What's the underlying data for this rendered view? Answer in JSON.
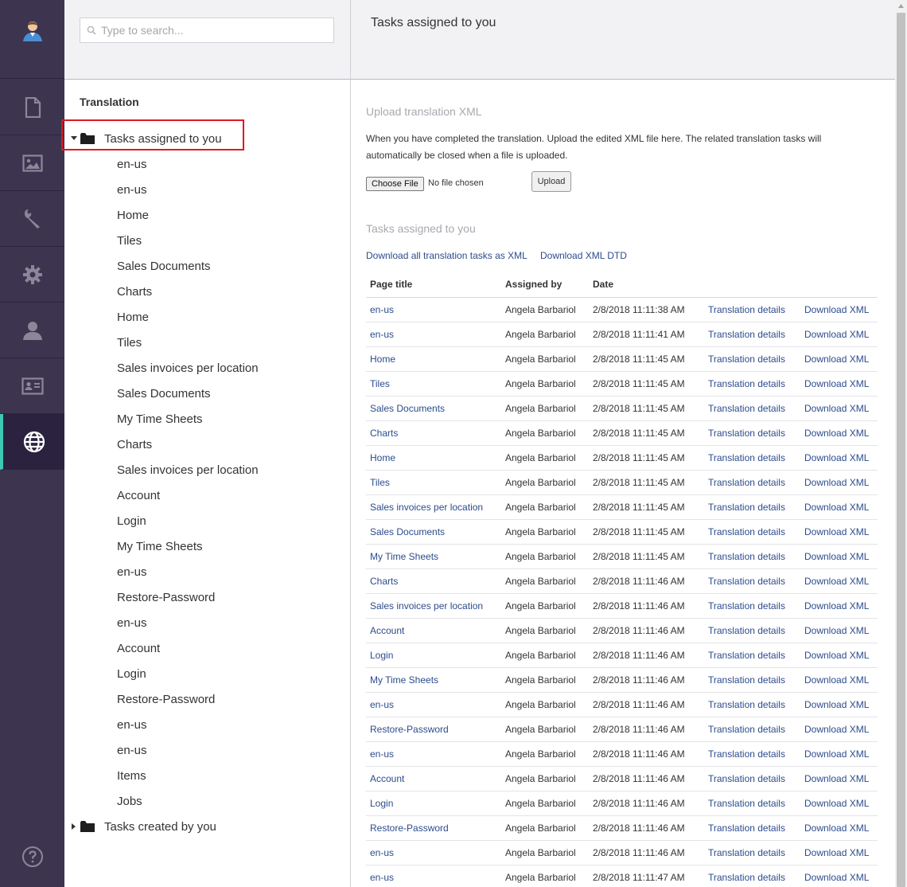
{
  "rail": {
    "items": [
      {
        "name": "documents",
        "icon": "document-icon"
      },
      {
        "name": "media",
        "icon": "image-icon"
      },
      {
        "name": "tools",
        "icon": "wrench-icon"
      },
      {
        "name": "settings",
        "icon": "gear-icon"
      },
      {
        "name": "users",
        "icon": "user-icon"
      },
      {
        "name": "contacts",
        "icon": "id-card-icon"
      },
      {
        "name": "translation",
        "icon": "globe-icon",
        "active": true
      }
    ],
    "active_color": "#3cc9b5",
    "background": "#3d3550"
  },
  "search": {
    "placeholder": "Type to search...",
    "value": ""
  },
  "tree": {
    "title": "Translation",
    "assigned_label": "Tasks assigned to you",
    "created_label": "Tasks created by you",
    "children": [
      "en-us",
      "en-us",
      "Home",
      "Tiles",
      "Sales Documents",
      "Charts",
      "Home",
      "Tiles",
      "Sales invoices per location",
      "Sales Documents",
      "My Time Sheets",
      "Charts",
      "Sales invoices per location",
      "Account",
      "Login",
      "My Time Sheets",
      "en-us",
      "Restore-Password",
      "en-us",
      "Account",
      "Login",
      "Restore-Password",
      "en-us",
      "en-us",
      "Items",
      "Jobs"
    ]
  },
  "main": {
    "title": "Tasks assigned to you",
    "upload_heading": "Upload translation XML",
    "upload_desc": "When you have completed the translation. Upload the edited XML file here. The related translation tasks will automatically be closed when a file is uploaded.",
    "choose_file_label": "Choose File",
    "no_file_label": "No file chosen",
    "upload_button": "Upload",
    "tasks_heading": "Tasks assigned to you",
    "download_all_label": "Download all translation tasks as XML",
    "download_dtd_label": "Download XML DTD",
    "columns": {
      "page_title": "Page title",
      "assigned_by": "Assigned by",
      "date": "Date"
    },
    "details_label": "Translation details",
    "download_label": "Download XML",
    "rows": [
      {
        "title": "en-us",
        "by": "Angela Barbariol",
        "date": "2/8/2018 11:11:38 AM"
      },
      {
        "title": "en-us",
        "by": "Angela Barbariol",
        "date": "2/8/2018 11:11:41 AM"
      },
      {
        "title": "Home",
        "by": "Angela Barbariol",
        "date": "2/8/2018 11:11:45 AM"
      },
      {
        "title": "Tiles",
        "by": "Angela Barbariol",
        "date": "2/8/2018 11:11:45 AM"
      },
      {
        "title": "Sales Documents",
        "by": "Angela Barbariol",
        "date": "2/8/2018 11:11:45 AM"
      },
      {
        "title": "Charts",
        "by": "Angela Barbariol",
        "date": "2/8/2018 11:11:45 AM"
      },
      {
        "title": "Home",
        "by": "Angela Barbariol",
        "date": "2/8/2018 11:11:45 AM"
      },
      {
        "title": "Tiles",
        "by": "Angela Barbariol",
        "date": "2/8/2018 11:11:45 AM"
      },
      {
        "title": "Sales invoices per location",
        "by": "Angela Barbariol",
        "date": "2/8/2018 11:11:45 AM"
      },
      {
        "title": "Sales Documents",
        "by": "Angela Barbariol",
        "date": "2/8/2018 11:11:45 AM"
      },
      {
        "title": "My Time Sheets",
        "by": "Angela Barbariol",
        "date": "2/8/2018 11:11:45 AM"
      },
      {
        "title": "Charts",
        "by": "Angela Barbariol",
        "date": "2/8/2018 11:11:46 AM"
      },
      {
        "title": "Sales invoices per location",
        "by": "Angela Barbariol",
        "date": "2/8/2018 11:11:46 AM"
      },
      {
        "title": "Account",
        "by": "Angela Barbariol",
        "date": "2/8/2018 11:11:46 AM"
      },
      {
        "title": "Login",
        "by": "Angela Barbariol",
        "date": "2/8/2018 11:11:46 AM"
      },
      {
        "title": "My Time Sheets",
        "by": "Angela Barbariol",
        "date": "2/8/2018 11:11:46 AM"
      },
      {
        "title": "en-us",
        "by": "Angela Barbariol",
        "date": "2/8/2018 11:11:46 AM"
      },
      {
        "title": "Restore-Password",
        "by": "Angela Barbariol",
        "date": "2/8/2018 11:11:46 AM"
      },
      {
        "title": "en-us",
        "by": "Angela Barbariol",
        "date": "2/8/2018 11:11:46 AM"
      },
      {
        "title": "Account",
        "by": "Angela Barbariol",
        "date": "2/8/2018 11:11:46 AM"
      },
      {
        "title": "Login",
        "by": "Angela Barbariol",
        "date": "2/8/2018 11:11:46 AM"
      },
      {
        "title": "Restore-Password",
        "by": "Angela Barbariol",
        "date": "2/8/2018 11:11:46 AM"
      },
      {
        "title": "en-us",
        "by": "Angela Barbariol",
        "date": "2/8/2018 11:11:46 AM"
      },
      {
        "title": "en-us",
        "by": "Angela Barbariol",
        "date": "2/8/2018 11:11:47 AM"
      }
    ]
  },
  "colors": {
    "link": "#2c4c8c",
    "highlight": "#e0191f",
    "muted_heading": "#a8a8b0"
  }
}
